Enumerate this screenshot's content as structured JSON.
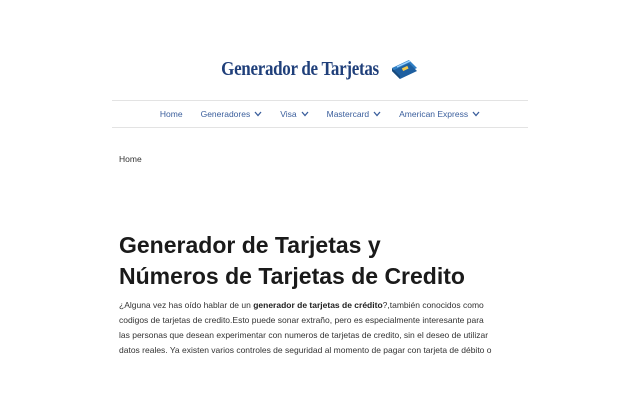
{
  "site": {
    "logo_text": "Generador de Tarjetas",
    "logo_icon": "credit-card-stack-icon"
  },
  "nav": {
    "items": [
      {
        "label": "Home",
        "has_dropdown": false
      },
      {
        "label": "Generadores",
        "has_dropdown": true
      },
      {
        "label": "Visa",
        "has_dropdown": true
      },
      {
        "label": "Mastercard",
        "has_dropdown": true
      },
      {
        "label": "American Express",
        "has_dropdown": true
      }
    ]
  },
  "breadcrumb": {
    "home": "Home"
  },
  "article": {
    "title_line1": "Generador de Tarjetas y",
    "title_line2": "Números de Tarjetas de Credito",
    "p1_a": "¿Alguna vez has oído hablar de un ",
    "p1_bold": "generador de tarjetas de crédito",
    "p1_b": "?,también conocidos como",
    "p1_line2": "codigos de tarjetas de credito.Esto puede sonar extraño, pero es especialmente interesante para",
    "p1_line3": "las personas que desean experimentar con numeros de tarjetas de credito, sin el deseo de utilizar",
    "p1_line4": "datos reales. Ya existen varios controles de seguridad al  momento de pagar con tarjeta de débito o"
  },
  "colors": {
    "nav_link": "#3a5e9c",
    "logo": "#1f3f7a",
    "title": "#1a1a1a"
  }
}
